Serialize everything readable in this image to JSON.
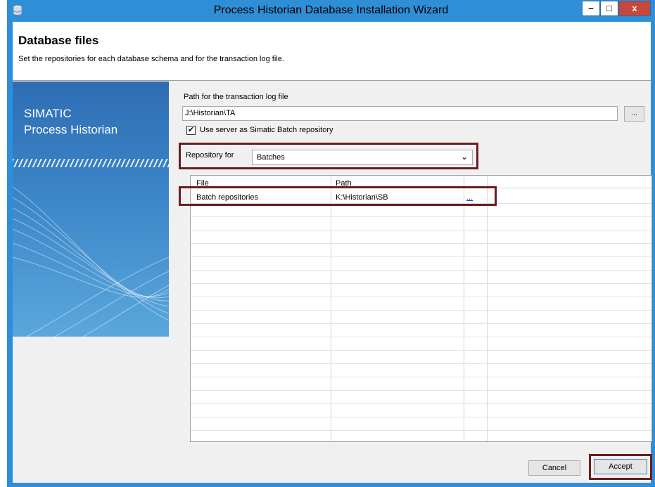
{
  "window": {
    "title": "Process Historian Database Installation Wizard",
    "controls": {
      "minimize": "–",
      "maximize": "□",
      "close": "x"
    },
    "titlebar_color": "#2e8ed6"
  },
  "header": {
    "title": "Database files",
    "subtitle": "Set the repositories for each database schema and for the transaction log file."
  },
  "sidebar": {
    "brand_line1": "SIMATIC",
    "brand_line2": "Process Historian"
  },
  "form": {
    "log_path_label": "Path for the transaction log file",
    "log_path_value": "J:\\Historian\\TA",
    "browse_label": "...",
    "use_server_checked": true,
    "checkbox_mark": "✔",
    "use_server_label": "Use server as Simatic Batch repository",
    "repository_label": "Repository for",
    "repository_value": "Batches",
    "repository_chevron": "⌄"
  },
  "grid": {
    "columns": [
      "File",
      "Path",
      ""
    ],
    "rows": [
      {
        "file": "Batch repositories",
        "path": "K:\\Historian\\SB",
        "action": "..."
      }
    ]
  },
  "buttons": {
    "cancel": "Cancel",
    "accept": "Accept"
  },
  "colors": {
    "highlight": "#6b1d1d",
    "link": "#1a33c8",
    "sidebar": "#3b86c8"
  },
  "icons": {
    "app": "database-icon",
    "chevron": "chevron-down-icon"
  }
}
